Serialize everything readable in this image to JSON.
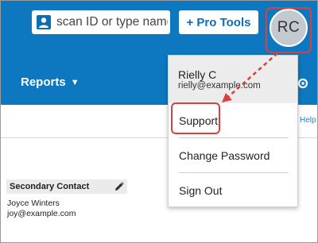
{
  "search": {
    "placeholder": "scan ID or type name",
    "icon": "person-icon"
  },
  "header": {
    "pro_tools_label": "+ Pro Tools",
    "avatar_initials": "RC",
    "reports_label": "Reports",
    "help_label": "Help"
  },
  "user_menu": {
    "name": "Rielly C",
    "email": "rielly@example.com",
    "items": [
      "Support",
      "Change Password",
      "Sign Out"
    ]
  },
  "contact": {
    "section_title": "Secondary Contact",
    "name": "Joyce Winters",
    "email": "joy@example.com"
  },
  "colors": {
    "brand_blue": "#0d78bf",
    "highlight_red": "#d9413f"
  }
}
